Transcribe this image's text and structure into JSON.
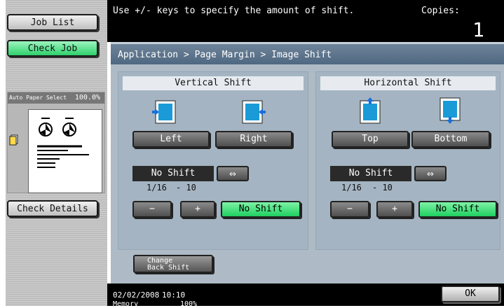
{
  "left": {
    "job_list": "Job List",
    "check_job": "Check Job",
    "preview": {
      "paper_label": "Auto Paper Select",
      "zoom": "100.0%"
    },
    "check_details": "Check Details"
  },
  "top": {
    "message": "Use +/- keys to specify the amount of shift.",
    "copies_label": "Copies:",
    "copies_value": "1"
  },
  "breadcrumb": "Application > Page Margin > Image Shift",
  "vertical": {
    "title": "Vertical Shift",
    "left": "Left",
    "right": "Right",
    "value": "No Shift",
    "fraction": "1/16",
    "range": "- 10",
    "minus": "−",
    "plus": "+",
    "no_shift": "No Shift"
  },
  "horizontal": {
    "title": "Horizontal Shift",
    "top": "Top",
    "bottom": "Bottom",
    "value": "No Shift",
    "fraction": "1/16",
    "range": "- 10",
    "minus": "−",
    "plus": "+",
    "no_shift": "No Shift"
  },
  "swap_icon": "⇔",
  "change_back_shift": {
    "line1": "Change",
    "line2": "Back Shift"
  },
  "bottom": {
    "date": "02/02/2008",
    "time": "10:10",
    "memory_label": "Memory",
    "memory_value": "100%"
  },
  "ok": "OK"
}
